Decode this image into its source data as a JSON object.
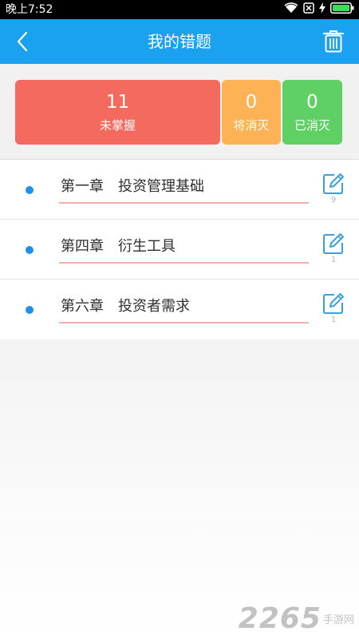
{
  "status_bar": {
    "time": "晚上7:52"
  },
  "header": {
    "title": "我的错题"
  },
  "stats": [
    {
      "value": "11",
      "label": "未掌握"
    },
    {
      "value": "0",
      "label": "将消灭"
    },
    {
      "value": "0",
      "label": "已消灭"
    }
  ],
  "chapters": [
    {
      "title": "第一章　投资管理基础",
      "count": "9"
    },
    {
      "title": "第四章　衍生工具",
      "count": "1"
    },
    {
      "title": "第六章　投资者需求",
      "count": "1"
    }
  ],
  "colors": {
    "header": "#1aa1f0",
    "unmastered": "#f46a5f",
    "pending": "#fdb255",
    "cleared": "#5fd063",
    "bullet": "#1e90e6",
    "underline": "#f0b0ab"
  },
  "icons": {
    "back": "chevron-left-icon",
    "trash": "trash-icon",
    "edit": "edit-icon",
    "wifi": "wifi-icon",
    "sim": "sim-icon",
    "battery": "battery-icon"
  },
  "watermark": {
    "number": "2265",
    "text": "手游网"
  }
}
